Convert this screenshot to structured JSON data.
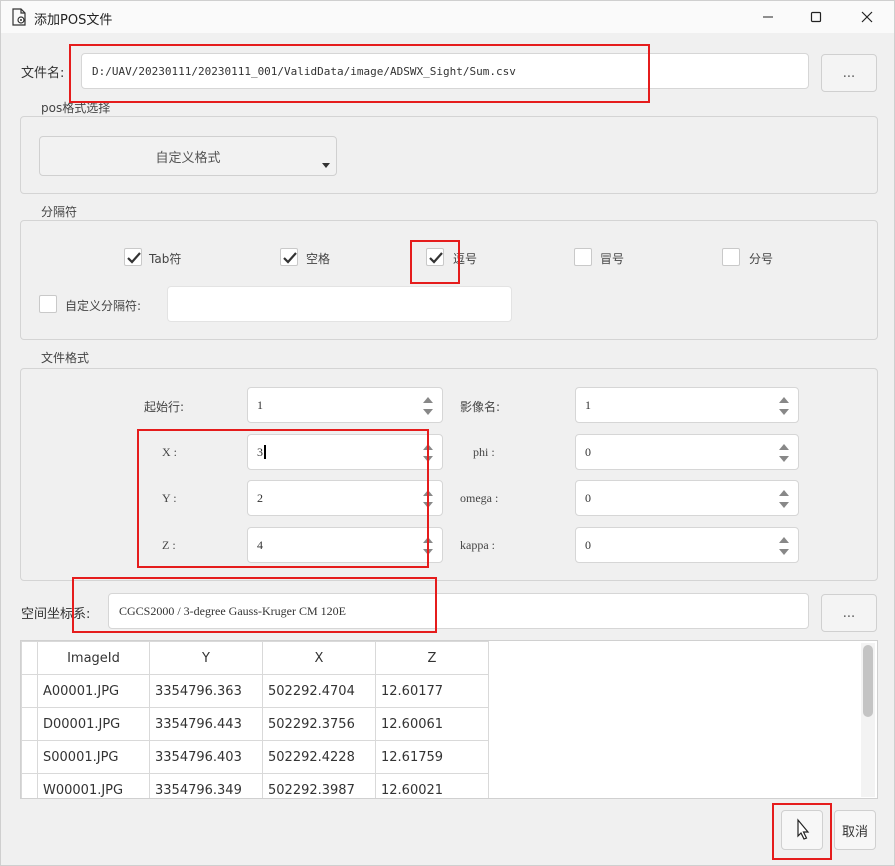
{
  "window": {
    "title": "添加POS文件"
  },
  "file": {
    "label": "文件名:",
    "path": "D:/UAV/20230111/20230111_001/ValidData/image/ADSWX_Sight/Sum.csv",
    "browse_label": "..."
  },
  "pos_format": {
    "group_label": "pos格式选择",
    "selected": "自定义格式"
  },
  "separator": {
    "group_label": "分隔符",
    "options": [
      {
        "label": "Tab符",
        "checked": true
      },
      {
        "label": "空格",
        "checked": true
      },
      {
        "label": "逗号",
        "checked": true
      },
      {
        "label": "冒号",
        "checked": false
      },
      {
        "label": "分号",
        "checked": false
      }
    ],
    "custom_label": "自定义分隔符:",
    "custom_value": ""
  },
  "file_format": {
    "group_label": "文件格式",
    "start_row_label": "起始行:",
    "start_row": "1",
    "x_label": "X :",
    "x": "3",
    "y_label": "Y :",
    "y": "2",
    "z_label": "Z :",
    "z": "4",
    "image_name_label": "影像名:",
    "image_name": "1",
    "phi_label": "phi :",
    "phi": "0",
    "omega_label": "omega :",
    "omega": "0",
    "kappa_label": "kappa :",
    "kappa": "0"
  },
  "crs": {
    "label": "空间坐标系:",
    "value": "CGCS2000 / 3-degree Gauss-Kruger CM 120E",
    "browse_label": "..."
  },
  "table": {
    "columns": [
      "ImageId",
      "Y",
      "X",
      "Z"
    ],
    "rows": [
      [
        "A00001.JPG",
        "3354796.363",
        "502292.4704",
        "12.60177"
      ],
      [
        "D00001.JPG",
        "3354796.443",
        "502292.3756",
        "12.60061"
      ],
      [
        "S00001.JPG",
        "3354796.403",
        "502292.4228",
        "12.61759"
      ],
      [
        "W00001.JPG",
        "3354796.349",
        "502292.3987",
        "12.60021"
      ]
    ]
  },
  "footer": {
    "cancel_label": "取消"
  },
  "colors": {
    "highlight": "#e51c1c"
  }
}
